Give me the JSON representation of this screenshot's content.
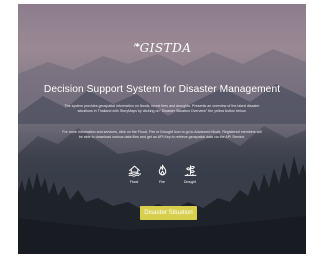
{
  "brand": {
    "logo_text": "GISTDA"
  },
  "hero": {
    "title": "Decision Support System for Disaster Management",
    "description_1": "The system provides geospatial information on floods, forest fires and droughts. Presents an overview of the latest disaster situations in Thailand with StoryMaps by clicking on \"Disaster Situation Overview\" the yellow button below.",
    "description_2": "For more information and services, click on the Flood, Fire or Drought icon to go to Advanced Mode. Registered members will be able to download various data files and get an API Key to retrieve geospatial data via the API Service."
  },
  "disaster_links": [
    {
      "label": "Flood",
      "icon": "flood-house-icon"
    },
    {
      "label": "Fire",
      "icon": "fire-flame-icon"
    },
    {
      "label": "Drought",
      "icon": "drought-cracked-icon"
    }
  ],
  "cta": {
    "label": "Disaster Situation"
  },
  "colors": {
    "accent": "#d8cf4c",
    "text": "#ffffff"
  }
}
